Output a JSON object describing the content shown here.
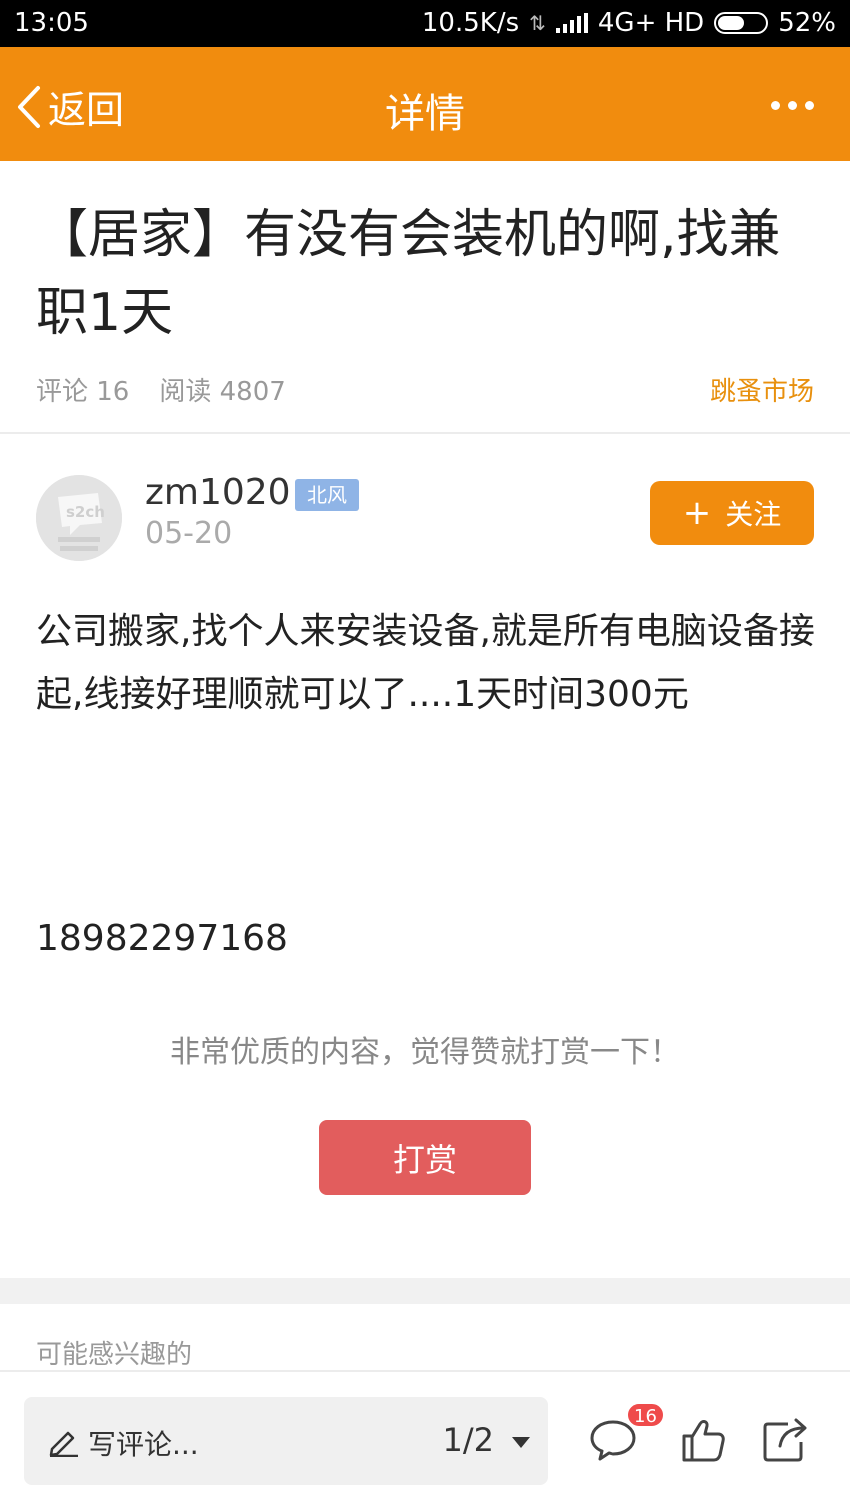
{
  "status_bar": {
    "time": "13:05",
    "speed": "10.5K/s",
    "network": "4G+ HD",
    "battery": "52%"
  },
  "header": {
    "back_label": "返回",
    "title": "详情"
  },
  "post": {
    "title": "【居家】有没有会装机的啊,找兼职1天",
    "comments_label": "评论 16",
    "reads_label": "阅读 4807",
    "category": "跳蚤市场"
  },
  "author": {
    "name": "zm1020",
    "badge": "北风",
    "date": "05-20",
    "follow_label": "关注",
    "avatar_text": "s2ch"
  },
  "content": {
    "text": "公司搬家,找个人来安装设备,就是所有电脑设备接起,线接好理顺就可以了....1天时间300元",
    "phone": "18982297168"
  },
  "reward": {
    "prompt": "非常优质的内容，觉得赞就打赏一下！",
    "button": "打赏"
  },
  "related": {
    "label": "可能感兴趣的"
  },
  "bottom_bar": {
    "comment_placeholder": "写评论...",
    "pages": "1/2",
    "comment_count": "16"
  },
  "colors": {
    "accent": "#f18c0e",
    "reward": "#e25d5d",
    "badge": "#8fb4e6"
  },
  "icons": [
    "back-chevron-icon",
    "more-icon",
    "plus-icon",
    "pen-icon",
    "dropdown-caret-icon",
    "comment-icon",
    "like-icon",
    "share-icon",
    "signal-icon",
    "battery-icon"
  ]
}
